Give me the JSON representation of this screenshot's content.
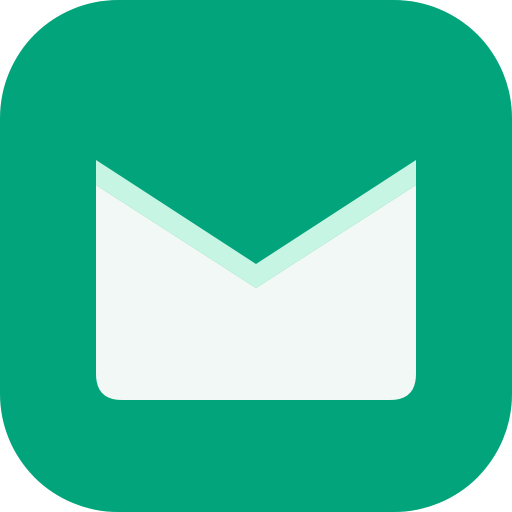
{
  "icon": {
    "name": "mail-app-icon",
    "colors": {
      "tile": "#02A47B",
      "envelope_body": "#F1F8F5",
      "envelope_flap": "#C7F5E3"
    }
  }
}
